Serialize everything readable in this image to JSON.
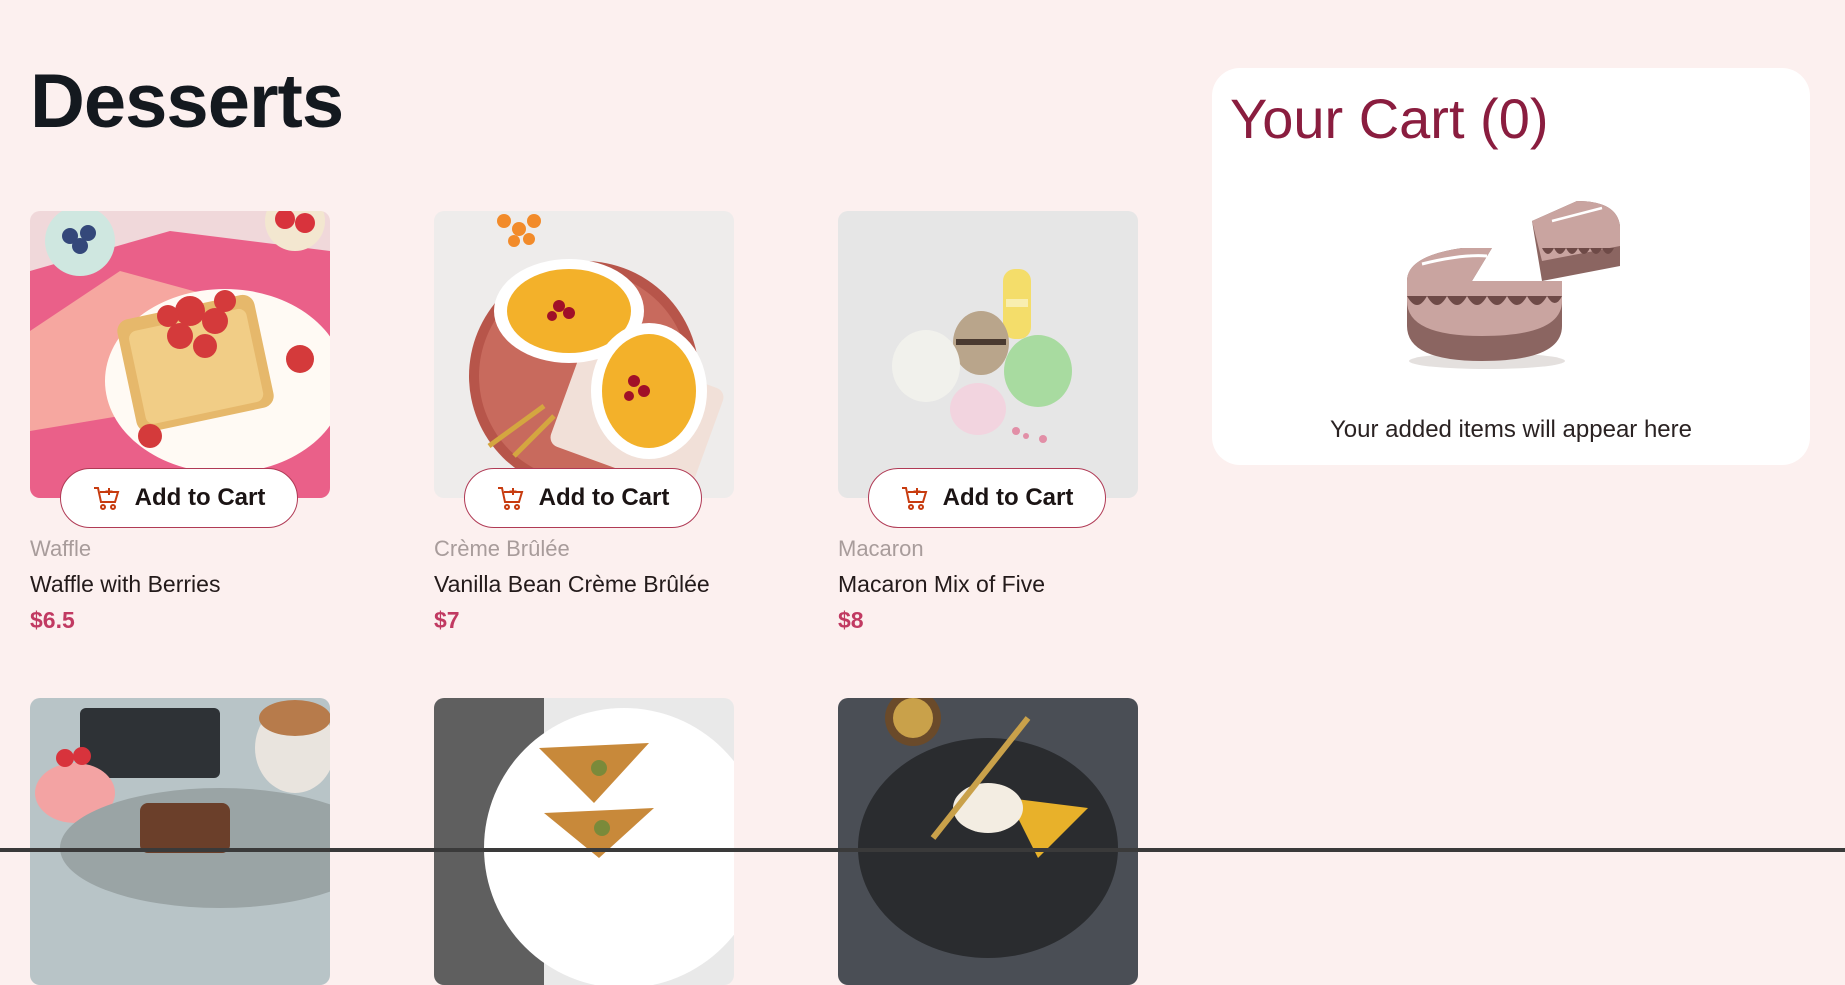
{
  "page": {
    "title": "Desserts"
  },
  "products": [
    {
      "category": "Waffle",
      "name": "Waffle with Berries",
      "price": "$6.5",
      "button": "Add to Cart"
    },
    {
      "category": "Crème Brûlée",
      "name": "Vanilla Bean Crème Brûlée",
      "price": "$7",
      "button": "Add to Cart"
    },
    {
      "category": "Macaron",
      "name": "Macaron Mix of Five",
      "price": "$8",
      "button": "Add to Cart"
    }
  ],
  "cart": {
    "title": "Your Cart (0)",
    "empty_message": "Your added items will appear here"
  },
  "colors": {
    "background": "#fcf0ef",
    "accent": "#c13a62",
    "cart_title": "#8a1d3f",
    "button_border": "#b03a55"
  },
  "icons": [
    "add-to-cart-icon",
    "empty-cart-cake-illustration"
  ]
}
